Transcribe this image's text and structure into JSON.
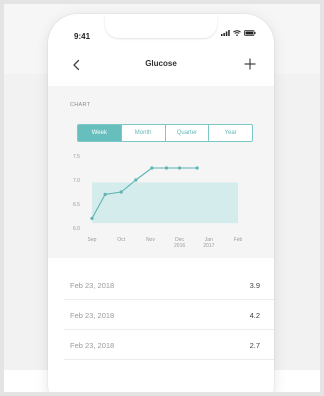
{
  "status_bar": {
    "time": "9:41"
  },
  "nav": {
    "title": "Glucose",
    "back_icon": "chevron-left-icon",
    "add_icon": "plus-icon"
  },
  "chart_section": {
    "label": "CHART",
    "tabs": [
      "Week",
      "Month",
      "Quarter",
      "Year"
    ],
    "active_tab": "Week"
  },
  "colors": {
    "accent": "#67bfbd",
    "line": "#5cb5b2",
    "range_band": "#d5ecec"
  },
  "chart_data": {
    "type": "line",
    "x": [
      "Sep",
      "Oct",
      "Nov",
      "Dec 2016",
      "Jan 2017",
      "Feb"
    ],
    "x_tick_lines": [
      [
        "Sep"
      ],
      [
        "Oct"
      ],
      [
        "Nov"
      ],
      [
        "Dec",
        "2016"
      ],
      [
        "Jan",
        "2017"
      ],
      [
        "Feb"
      ]
    ],
    "series": [
      {
        "x": [
          0,
          0.45,
          1.0,
          1.5,
          2.05,
          2.55,
          3.0,
          3.6
        ],
        "y": [
          6.2,
          6.7,
          6.75,
          7.0,
          7.25,
          7.25,
          7.25,
          7.25
        ]
      }
    ],
    "y_ticks": [
      "7.5",
      "7.0",
      "6.5",
      "6.0"
    ],
    "y_tick_values": [
      7.5,
      7.0,
      6.5,
      6.0
    ],
    "target_range": [
      6.1,
      6.95
    ],
    "ylim": [
      6.0,
      7.5
    ],
    "xlim": [
      0,
      5
    ]
  },
  "readings": [
    {
      "date": "Feb 23, 2018",
      "value": "3.9"
    },
    {
      "date": "Feb 23, 2018",
      "value": "4.2"
    },
    {
      "date": "Feb 23, 2018",
      "value": "2.7"
    }
  ]
}
